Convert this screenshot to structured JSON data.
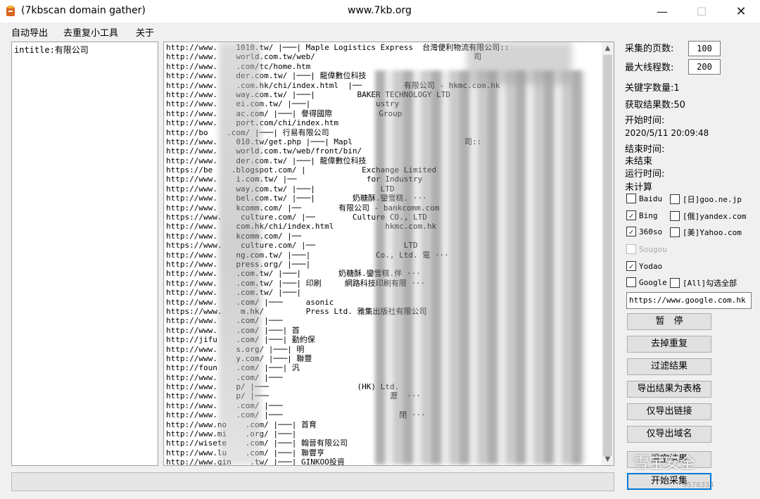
{
  "window": {
    "title_left": "(7kbscan domain gather)",
    "title_center": "www.7kb.org",
    "min": "—",
    "max": "☐",
    "close": "✕"
  },
  "menu": [
    "自动导出",
    "去重复小工具",
    "关于"
  ],
  "keywords": "intitle:有限公司",
  "results": [
    "http://www.    1010.tw/ |───| Maple Logistics Express  台灣便利物流有限公司::",
    "http://www.    world.com.tw/web/                                  司",
    "http://www.    .com/tc/home.htm",
    "http://www.    der.com.tw/ |───| 龍偉數位科技",
    "http://www.    .com.hk/chi/index.html  |──         有限公司 - hkmc.com.hk",
    "http://www.    way.com.tw/ |───|         BAKER TECHNOLOGY LTD",
    "http://www.    ei.com.tw/ |───|              ustry",
    "http://www.    ac.com/ |───| 譽得國際          Group",
    "http://www.    port.com/chi/index.htm",
    "http://bo    .com/ |───| 行易有限公司",
    "http://www.    010.tw/get.php |───| Mapl                        司::",
    "http://www.    world.com.tw/web/front/bin/",
    "http://www.    der.com.tw/ |───| 龍偉數位科技",
    "https://be    .blogspot.com/ |            Exchange Limited",
    "http://www.    i.com.tw/ |──               for Industry",
    "http://www.    way.com.tw/ |───|              LTD",
    "http://www.    bel.com.tw/ |───|        奶糖酥.鑾雪糕. ···",
    "http://www.    kcomm.com/ |──        有限公司 - bankcomm.com",
    "https://www.    culture.com/ |──        Culture CO., LTD",
    "http://www.    com.hk/chi/index.html           hkmc.com.hk",
    "http://www.    kcomm.com/ |──",
    "https://www.    culture.com/ |──                   LTD",
    "http://www.    ng.com.tw/ |───|              Co., Ltd. 電 ···",
    "http://www.    press.org/ |───|",
    "http://www.    .com.tw/ |───|        奶糖酥.鑾雪糕.伴 ···",
    "http://www.    .com.tw/ |───| 印刷     網路科技印刷有限 ···",
    "http://www.    .com.tw/ |───|",
    "http://www.    .com/ |───     asonic",
    "https://www.    m.hk/         Press Ltd. 雅集出版社有限公司",
    "http://www.    .com/ |───",
    "http://www.    .com/ |───| 首",
    "http://jifu    .com/ |───| 勤約保",
    "http://www.    s.org/ |───| 明      ",
    "http://www.    y.com/ |───| 聯豐",
    "http://foun    .com/ |───| 汎",
    "http://www.    .com/ |───",
    "http://www.    p/ |───                   (HK) Ltd.",
    "http://www.    p/ |───                          瀝  ···",
    "http://www.    .com/ |───",
    "http://www.    .com/ |───                         閉 ···",
    "http://www.no    .com/ |───| 首育",
    "http://www.mi    .org/ |───|",
    "http://wisete    .com/ |───| 翰晉有限公司",
    "http://www.lu    .com/ |───| 聯豐亨",
    "http://www.gin    .tw/ |───| GINKOO投資"
  ],
  "scroll": {
    "up": "▲",
    "down": "▼"
  },
  "settings": {
    "pages_label": "采集的页数:",
    "pages_value": "100",
    "threads_label": "最大线程数:",
    "threads_value": "200",
    "keyword_count": "关键字数量:1",
    "result_count": "获取结果数:50",
    "start_label": "开始时间:",
    "start_value": "2020/5/11 20:09:48",
    "end_label": "结束时间:",
    "end_value": "未结束",
    "run_label": "运行时间:",
    "run_value": "未计算"
  },
  "engines": [
    {
      "label": "Baidu",
      "checked": false
    },
    {
      "label": "[日]goo.ne.jp",
      "checked": false
    },
    {
      "label": "Bing",
      "checked": true
    },
    {
      "label": "[俄]yandex.com",
      "checked": false
    },
    {
      "label": "360so",
      "checked": true
    },
    {
      "label": "[美]Yahoo.com",
      "checked": false
    },
    {
      "label": "Sougou",
      "checked": false,
      "disabled": true
    },
    {
      "label": "Yodao",
      "checked": true
    },
    {
      "label": "Google",
      "checked": false
    },
    {
      "label": "[All]勾选全部",
      "checked": false
    }
  ],
  "google_url": "https://www.google.com.hk",
  "buttons": {
    "pause": "暂　停",
    "dedupe": "去掉重复",
    "filter": "过滤结果",
    "export_table": "导出结果为表格",
    "export_links": "仅导出链接",
    "export_domains": "仅导出域名",
    "clear": "清空结果",
    "start": "开始采集"
  },
  "watermark": "雪宝安全",
  "watermark_small": "9578334"
}
